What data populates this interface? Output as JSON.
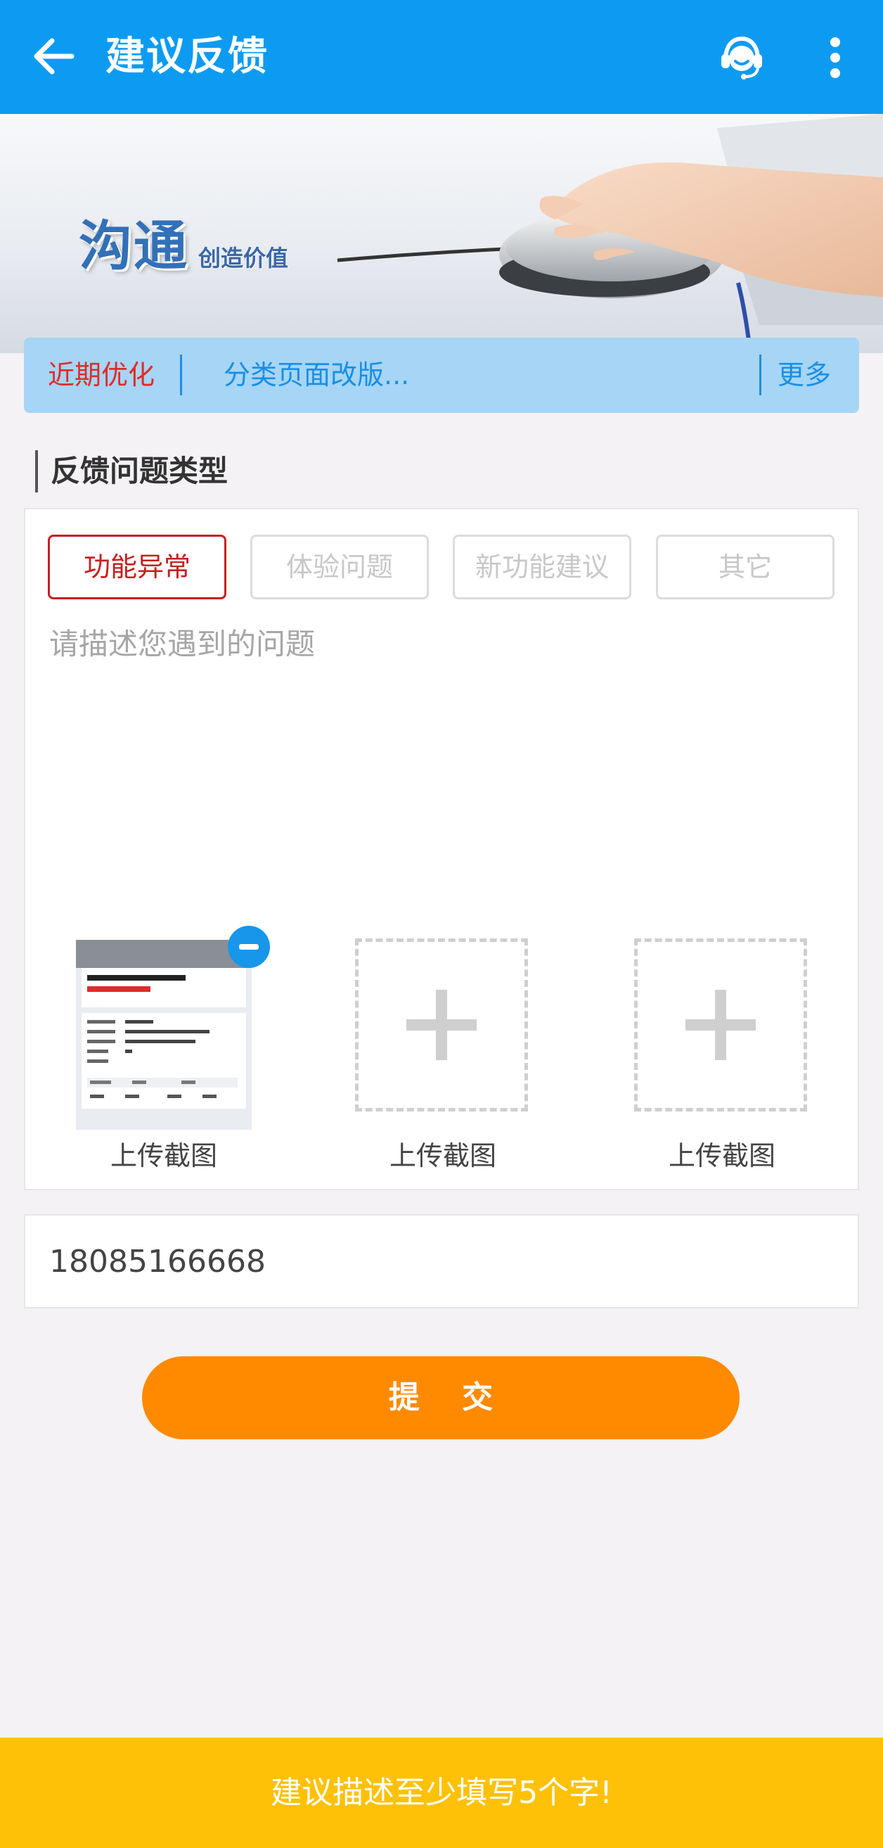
{
  "header": {
    "title": "建议反馈",
    "back_icon": "arrow-left-icon",
    "service_icon": "headset-icon",
    "menu_icon": "more-vertical-icon"
  },
  "banner": {
    "big_text": "沟通",
    "small_text": "创造价值"
  },
  "notice": {
    "tag": "近期优化",
    "text": "分类页面改版...",
    "more": "更多"
  },
  "feedback": {
    "section_title": "反馈问题类型",
    "types": [
      {
        "label": "功能异常",
        "active": true
      },
      {
        "label": "体验问题",
        "active": false
      },
      {
        "label": "新功能建议",
        "active": false
      },
      {
        "label": "其它",
        "active": false
      }
    ],
    "description_placeholder": "请描述您遇到的问题",
    "uploads": [
      {
        "label": "上传截图",
        "filled": true
      },
      {
        "label": "上传截图",
        "filled": false
      },
      {
        "label": "上传截图",
        "filled": false
      }
    ]
  },
  "contact": {
    "phone": "18085166668"
  },
  "submit": {
    "label": "提 交"
  },
  "toast": {
    "message": "建议描述至少填写5个字!"
  },
  "colors": {
    "header_bg": "#0d9bf2",
    "active_type": "#c81e1e",
    "submit_bg": "#ff8a00",
    "toast_bg": "#ffc107"
  }
}
